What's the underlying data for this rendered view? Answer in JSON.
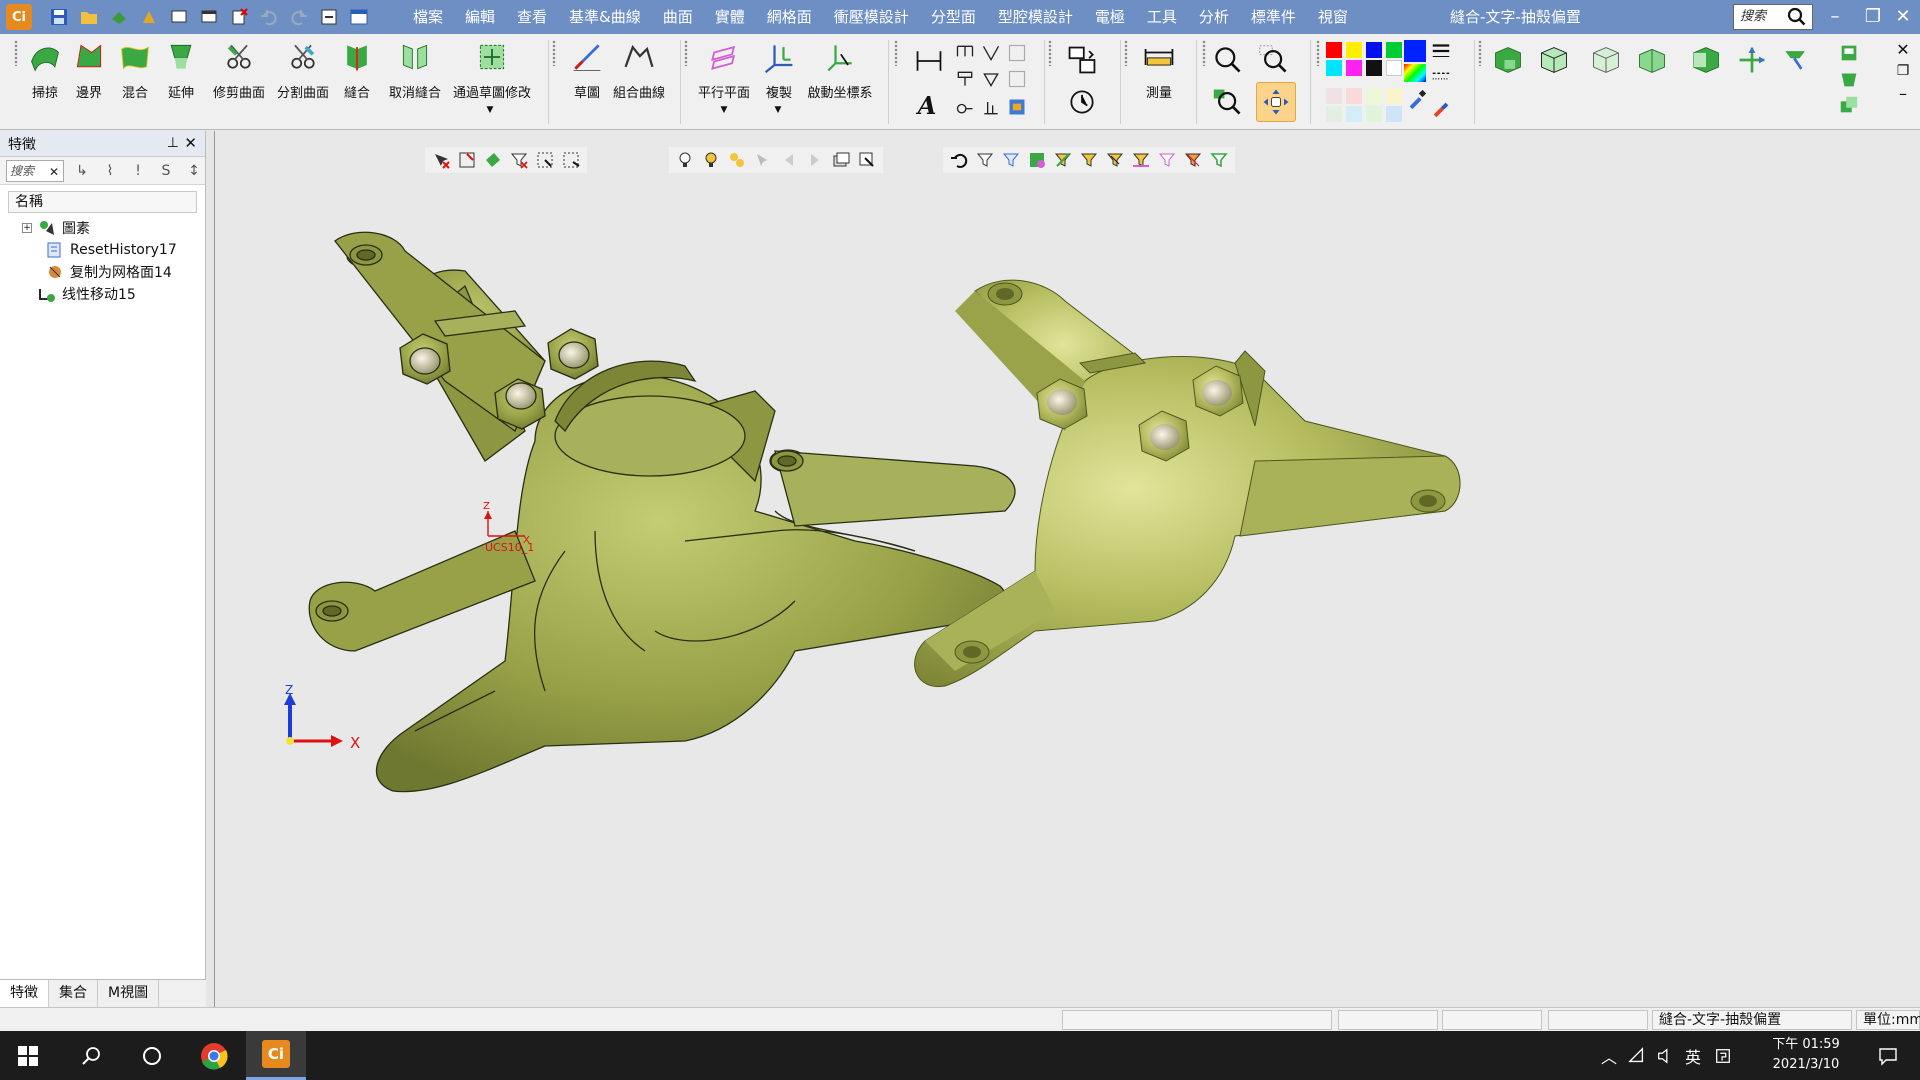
{
  "app": {
    "icon_label": "Ci",
    "document_title": "縫合-文字-抽殼偏置",
    "search_placeholder": "搜索"
  },
  "menu": [
    "檔案",
    "編輯",
    "查看",
    "基準&曲線",
    "曲面",
    "實體",
    "網格面",
    "衝壓模設計",
    "分型面",
    "型腔模設計",
    "電極",
    "工具",
    "分析",
    "標準件",
    "視窗"
  ],
  "ribbon": {
    "buttons": [
      {
        "id": "sweep",
        "label": "掃掠"
      },
      {
        "id": "boundary",
        "label": "邊界"
      },
      {
        "id": "blend",
        "label": "混合"
      },
      {
        "id": "extend",
        "label": "延伸"
      },
      {
        "id": "trim",
        "label": "修剪曲面"
      },
      {
        "id": "split",
        "label": "分割曲面"
      },
      {
        "id": "sew",
        "label": "縫合"
      },
      {
        "id": "unsew",
        "label": "取消縫合"
      },
      {
        "id": "sketch-modify",
        "label": "通過草圖修改"
      },
      {
        "id": "sketch",
        "label": "草圖"
      },
      {
        "id": "composite-curve",
        "label": "組合曲線"
      },
      {
        "id": "parallel-plane",
        "label": "平行平面"
      },
      {
        "id": "copy",
        "label": "複製"
      },
      {
        "id": "activate-cs",
        "label": "啟動坐標系"
      },
      {
        "id": "measure",
        "label": "測量"
      }
    ],
    "colors": [
      "#ff0000",
      "#ffee00",
      "#0011ee",
      "#00cc33",
      "#0022ff",
      "#00e5ff",
      "#ff22ee",
      "#111111",
      "#ffffff"
    ]
  },
  "left_panel": {
    "title": "特徵",
    "search_placeholder": "搜索",
    "column_header": "名稱",
    "tree": [
      {
        "label": "圖素",
        "icon": "entities-icon",
        "expandable": true
      },
      {
        "label": "ResetHistory17",
        "icon": "reset-history-icon"
      },
      {
        "label": "复制为网格面14",
        "icon": "copy-mesh-icon"
      },
      {
        "label": "线性移动15",
        "icon": "linear-move-icon"
      }
    ],
    "tabs": [
      "特徵",
      "集合",
      "M視圖"
    ]
  },
  "viewport": {
    "ucs_label": "UCS10_1",
    "ucs_axis_z": "Z",
    "ucs_axis_x": "X",
    "triad_z": "Z",
    "triad_x": "X",
    "model_color": "#9ba44a"
  },
  "status_bar": {
    "doc_name": "縫合-文字-抽殼偏置",
    "units": "單位:mm"
  },
  "taskbar": {
    "time": "下午 01:59",
    "date": "2021/3/10",
    "ime": "英"
  }
}
